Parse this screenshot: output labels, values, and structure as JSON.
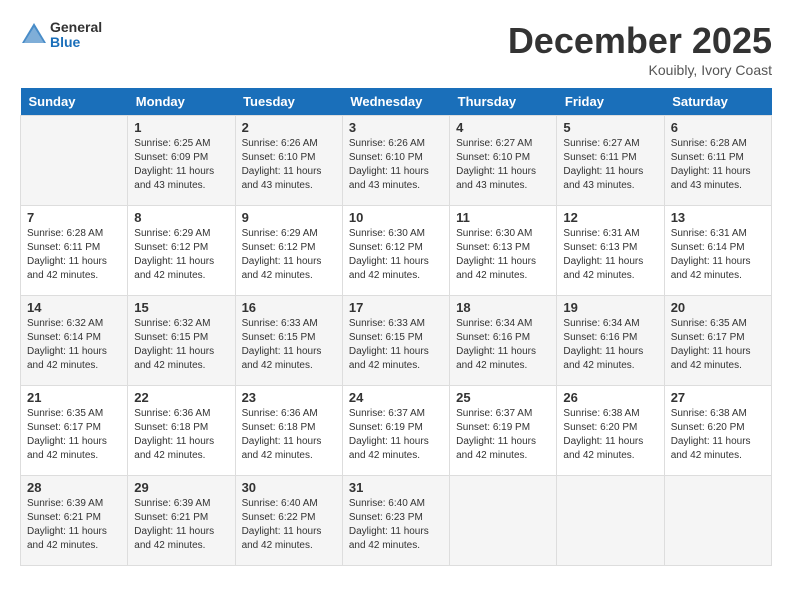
{
  "logo": {
    "text_general": "General",
    "text_blue": "Blue"
  },
  "header": {
    "month": "December 2025",
    "location": "Kouibly, Ivory Coast"
  },
  "weekdays": [
    "Sunday",
    "Monday",
    "Tuesday",
    "Wednesday",
    "Thursday",
    "Friday",
    "Saturday"
  ],
  "weeks": [
    [
      {
        "day": "",
        "sunrise": "",
        "sunset": "",
        "daylight": ""
      },
      {
        "day": "1",
        "sunrise": "Sunrise: 6:25 AM",
        "sunset": "Sunset: 6:09 PM",
        "daylight": "Daylight: 11 hours and 43 minutes."
      },
      {
        "day": "2",
        "sunrise": "Sunrise: 6:26 AM",
        "sunset": "Sunset: 6:10 PM",
        "daylight": "Daylight: 11 hours and 43 minutes."
      },
      {
        "day": "3",
        "sunrise": "Sunrise: 6:26 AM",
        "sunset": "Sunset: 6:10 PM",
        "daylight": "Daylight: 11 hours and 43 minutes."
      },
      {
        "day": "4",
        "sunrise": "Sunrise: 6:27 AM",
        "sunset": "Sunset: 6:10 PM",
        "daylight": "Daylight: 11 hours and 43 minutes."
      },
      {
        "day": "5",
        "sunrise": "Sunrise: 6:27 AM",
        "sunset": "Sunset: 6:11 PM",
        "daylight": "Daylight: 11 hours and 43 minutes."
      },
      {
        "day": "6",
        "sunrise": "Sunrise: 6:28 AM",
        "sunset": "Sunset: 6:11 PM",
        "daylight": "Daylight: 11 hours and 43 minutes."
      }
    ],
    [
      {
        "day": "7",
        "sunrise": "Sunrise: 6:28 AM",
        "sunset": "Sunset: 6:11 PM",
        "daylight": "Daylight: 11 hours and 42 minutes."
      },
      {
        "day": "8",
        "sunrise": "Sunrise: 6:29 AM",
        "sunset": "Sunset: 6:12 PM",
        "daylight": "Daylight: 11 hours and 42 minutes."
      },
      {
        "day": "9",
        "sunrise": "Sunrise: 6:29 AM",
        "sunset": "Sunset: 6:12 PM",
        "daylight": "Daylight: 11 hours and 42 minutes."
      },
      {
        "day": "10",
        "sunrise": "Sunrise: 6:30 AM",
        "sunset": "Sunset: 6:12 PM",
        "daylight": "Daylight: 11 hours and 42 minutes."
      },
      {
        "day": "11",
        "sunrise": "Sunrise: 6:30 AM",
        "sunset": "Sunset: 6:13 PM",
        "daylight": "Daylight: 11 hours and 42 minutes."
      },
      {
        "day": "12",
        "sunrise": "Sunrise: 6:31 AM",
        "sunset": "Sunset: 6:13 PM",
        "daylight": "Daylight: 11 hours and 42 minutes."
      },
      {
        "day": "13",
        "sunrise": "Sunrise: 6:31 AM",
        "sunset": "Sunset: 6:14 PM",
        "daylight": "Daylight: 11 hours and 42 minutes."
      }
    ],
    [
      {
        "day": "14",
        "sunrise": "Sunrise: 6:32 AM",
        "sunset": "Sunset: 6:14 PM",
        "daylight": "Daylight: 11 hours and 42 minutes."
      },
      {
        "day": "15",
        "sunrise": "Sunrise: 6:32 AM",
        "sunset": "Sunset: 6:15 PM",
        "daylight": "Daylight: 11 hours and 42 minutes."
      },
      {
        "day": "16",
        "sunrise": "Sunrise: 6:33 AM",
        "sunset": "Sunset: 6:15 PM",
        "daylight": "Daylight: 11 hours and 42 minutes."
      },
      {
        "day": "17",
        "sunrise": "Sunrise: 6:33 AM",
        "sunset": "Sunset: 6:15 PM",
        "daylight": "Daylight: 11 hours and 42 minutes."
      },
      {
        "day": "18",
        "sunrise": "Sunrise: 6:34 AM",
        "sunset": "Sunset: 6:16 PM",
        "daylight": "Daylight: 11 hours and 42 minutes."
      },
      {
        "day": "19",
        "sunrise": "Sunrise: 6:34 AM",
        "sunset": "Sunset: 6:16 PM",
        "daylight": "Daylight: 11 hours and 42 minutes."
      },
      {
        "day": "20",
        "sunrise": "Sunrise: 6:35 AM",
        "sunset": "Sunset: 6:17 PM",
        "daylight": "Daylight: 11 hours and 42 minutes."
      }
    ],
    [
      {
        "day": "21",
        "sunrise": "Sunrise: 6:35 AM",
        "sunset": "Sunset: 6:17 PM",
        "daylight": "Daylight: 11 hours and 42 minutes."
      },
      {
        "day": "22",
        "sunrise": "Sunrise: 6:36 AM",
        "sunset": "Sunset: 6:18 PM",
        "daylight": "Daylight: 11 hours and 42 minutes."
      },
      {
        "day": "23",
        "sunrise": "Sunrise: 6:36 AM",
        "sunset": "Sunset: 6:18 PM",
        "daylight": "Daylight: 11 hours and 42 minutes."
      },
      {
        "day": "24",
        "sunrise": "Sunrise: 6:37 AM",
        "sunset": "Sunset: 6:19 PM",
        "daylight": "Daylight: 11 hours and 42 minutes."
      },
      {
        "day": "25",
        "sunrise": "Sunrise: 6:37 AM",
        "sunset": "Sunset: 6:19 PM",
        "daylight": "Daylight: 11 hours and 42 minutes."
      },
      {
        "day": "26",
        "sunrise": "Sunrise: 6:38 AM",
        "sunset": "Sunset: 6:20 PM",
        "daylight": "Daylight: 11 hours and 42 minutes."
      },
      {
        "day": "27",
        "sunrise": "Sunrise: 6:38 AM",
        "sunset": "Sunset: 6:20 PM",
        "daylight": "Daylight: 11 hours and 42 minutes."
      }
    ],
    [
      {
        "day": "28",
        "sunrise": "Sunrise: 6:39 AM",
        "sunset": "Sunset: 6:21 PM",
        "daylight": "Daylight: 11 hours and 42 minutes."
      },
      {
        "day": "29",
        "sunrise": "Sunrise: 6:39 AM",
        "sunset": "Sunset: 6:21 PM",
        "daylight": "Daylight: 11 hours and 42 minutes."
      },
      {
        "day": "30",
        "sunrise": "Sunrise: 6:40 AM",
        "sunset": "Sunset: 6:22 PM",
        "daylight": "Daylight: 11 hours and 42 minutes."
      },
      {
        "day": "31",
        "sunrise": "Sunrise: 6:40 AM",
        "sunset": "Sunset: 6:23 PM",
        "daylight": "Daylight: 11 hours and 42 minutes."
      },
      {
        "day": "",
        "sunrise": "",
        "sunset": "",
        "daylight": ""
      },
      {
        "day": "",
        "sunrise": "",
        "sunset": "",
        "daylight": ""
      },
      {
        "day": "",
        "sunrise": "",
        "sunset": "",
        "daylight": ""
      }
    ]
  ]
}
